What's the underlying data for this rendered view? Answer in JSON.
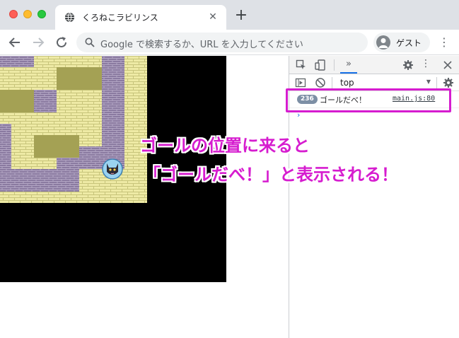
{
  "browser": {
    "tab": {
      "title": "くろねこラビリンス",
      "favicon": "globe-icon"
    },
    "omnibox": {
      "placeholder": "Google で検索するか、URL を入力してください"
    },
    "profile": {
      "label": "ゲスト"
    }
  },
  "game": {
    "tiles": {
      "colors": {
        "brick": "#eeeaa5",
        "brick_mortar": "#c7c47a",
        "wall": "#8a7aa0",
        "wall_mortar": "#b3a6c4",
        "goal": "#a4a154",
        "void": "#000000"
      }
    },
    "character": "black-cat-sprite"
  },
  "devtools": {
    "context": "top",
    "console": {
      "entry": {
        "count": "236",
        "message": "ゴールだべ！",
        "source": "main.js:80"
      }
    }
  },
  "annotation": {
    "line1": "ゴールの位置に来ると",
    "line2": "「ゴールだべ！」と表示される！",
    "color": "#d61ccf"
  }
}
